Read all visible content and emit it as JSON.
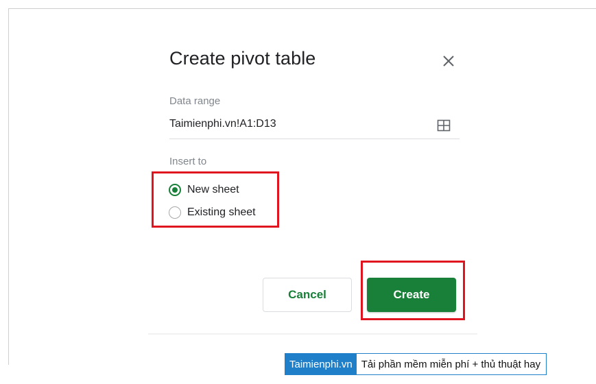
{
  "dialog": {
    "title": "Create pivot table",
    "close_icon": "close-icon",
    "data_range": {
      "label": "Data range",
      "value": "Taimienphi.vn!A1:D13",
      "select_icon": "grid-icon"
    },
    "insert_to": {
      "label": "Insert to",
      "options": [
        {
          "label": "New sheet",
          "selected": true
        },
        {
          "label": "Existing sheet",
          "selected": false
        }
      ]
    },
    "buttons": {
      "cancel_label": "Cancel",
      "create_label": "Create"
    }
  },
  "colors": {
    "accent_green": "#188038",
    "highlight_red": "#e0141e",
    "brand_blue": "#1f7fc8"
  },
  "watermark": {
    "brand": "Taimienphi.vn",
    "slogan": "Tải phần mềm miễn phí + thủ thuật hay"
  }
}
